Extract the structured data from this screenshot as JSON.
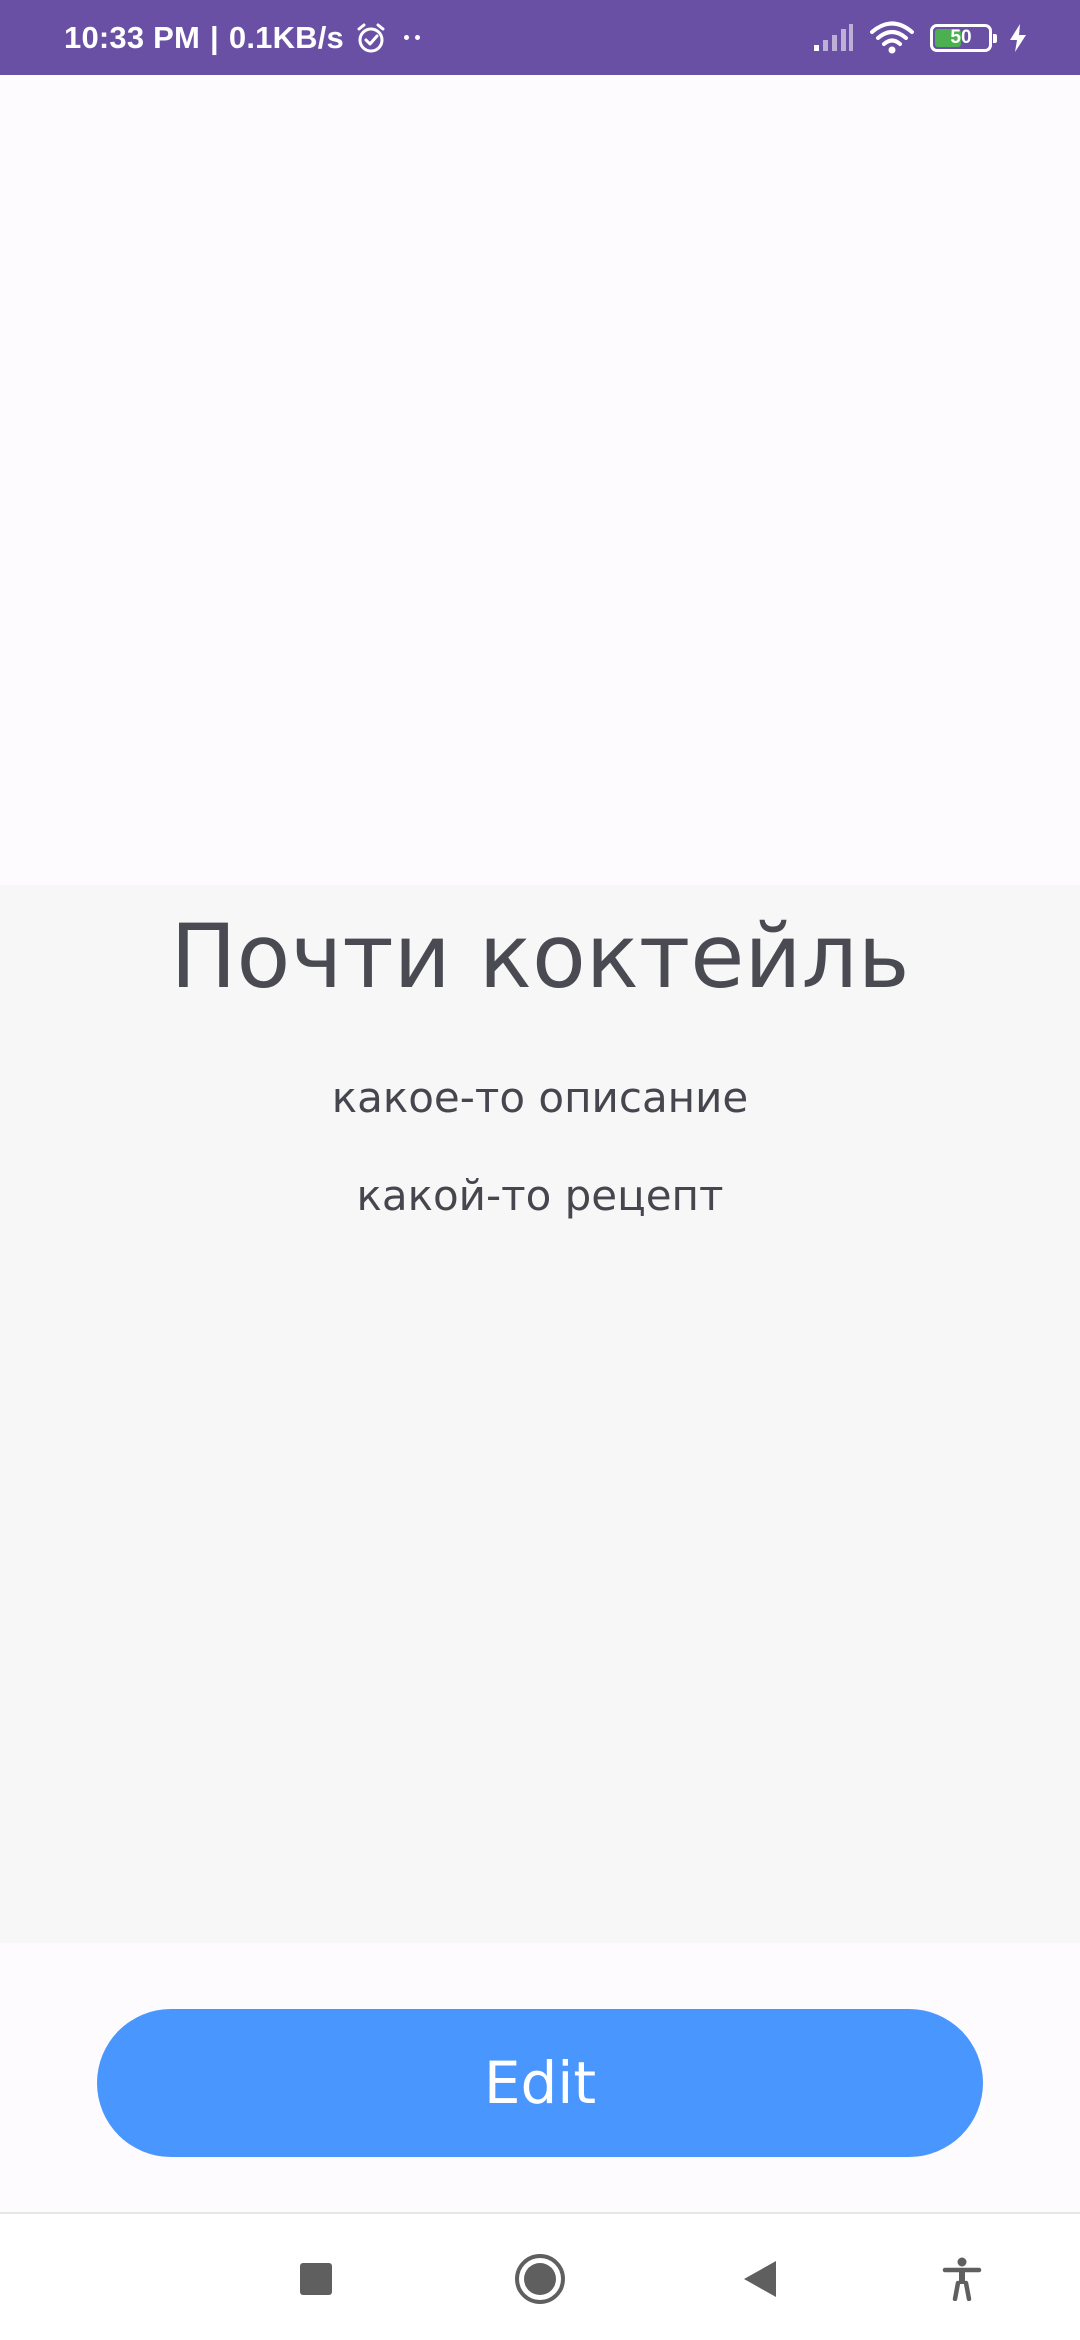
{
  "status_bar": {
    "time": "10:33 PM",
    "separator": "|",
    "net_speed": "0.1KB/s",
    "battery_percent": "50",
    "battery_level": 0.5,
    "icons": [
      "alarm-icon",
      "more-dots-icon",
      "signal-icon",
      "wifi-icon",
      "battery-icon",
      "charging-icon"
    ],
    "color": "#6a50a4"
  },
  "card": {
    "title": "Почти коктейль",
    "description": "какое-то описание",
    "recipe": "какой-то рецепт"
  },
  "actions": {
    "edit_label": "Edit",
    "edit_color": "#4a96ff"
  },
  "nav_bar": {
    "icons": [
      "recents-icon",
      "home-icon",
      "back-icon",
      "accessibility-icon"
    ]
  }
}
